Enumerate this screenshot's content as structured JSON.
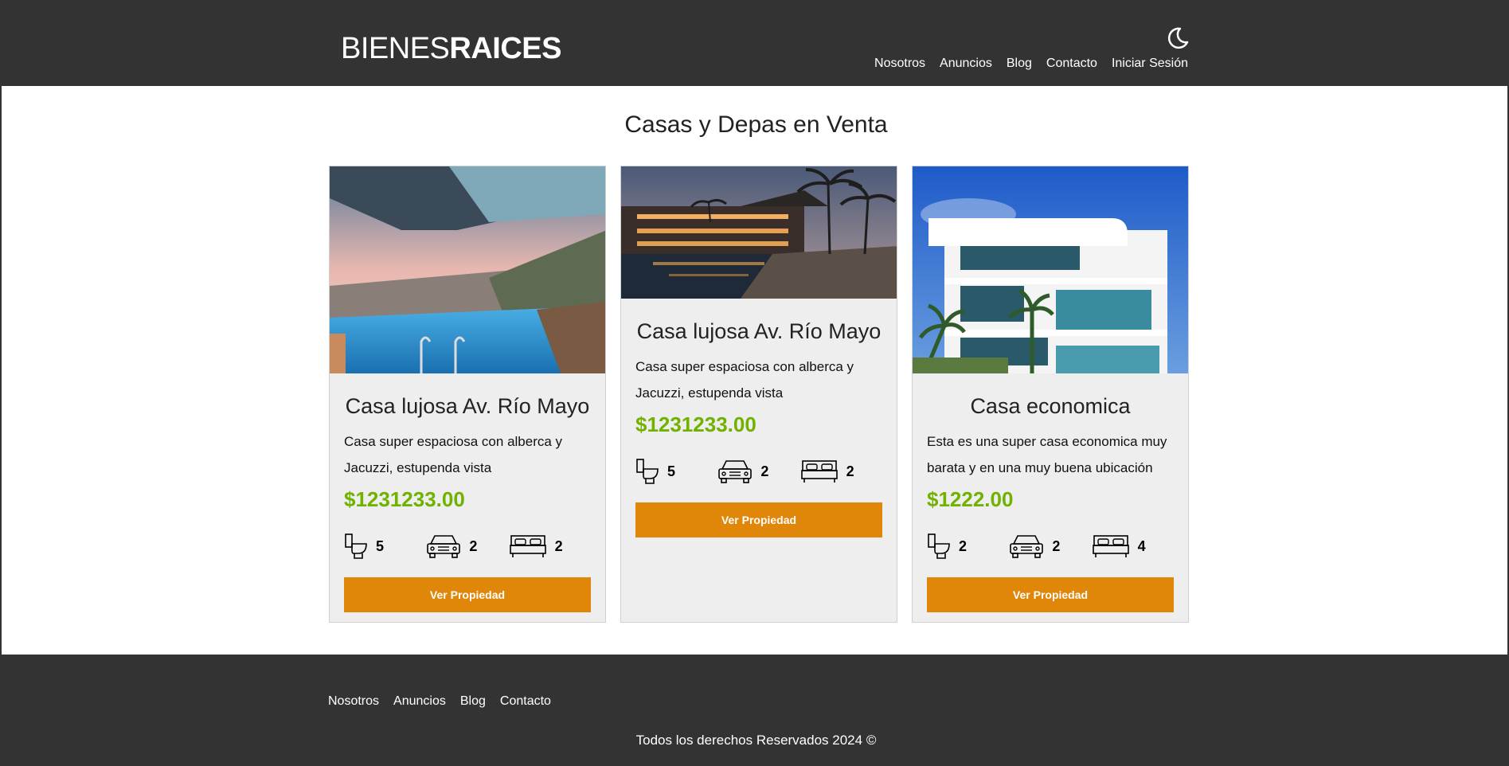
{
  "header": {
    "logo_light": "BIENES",
    "logo_bold": "RAICES",
    "theme_icon": "moon-icon",
    "nav": [
      "Nosotros",
      "Anuncios",
      "Blog",
      "Contacto",
      "Iniciar Sesión"
    ]
  },
  "main": {
    "title": "Casas y Depas en Venta",
    "cards": [
      {
        "image": "infinity-pool-sunset-photo",
        "title": "Casa lujosa Av. Río Mayo",
        "description": "Casa super espaciosa con alberca y Jacuzzi, estupenda vista",
        "price": "$1231233.00",
        "bathrooms": "5",
        "parking": "2",
        "bedrooms": "2",
        "button": "Ver Propiedad"
      },
      {
        "image": "resort-pool-night-photo",
        "title": "Casa lujosa Av. Río Mayo",
        "description": "Casa super espaciosa con alberca y Jacuzzi, estupenda vista",
        "price": "$1231233.00",
        "bathrooms": "5",
        "parking": "2",
        "bedrooms": "2",
        "button": "Ver Propiedad"
      },
      {
        "image": "modern-white-house-photo",
        "title": "Casa economica",
        "description": "Esta es una super casa economica muy barata y en una muy buena ubicación",
        "price": "$1222.00",
        "bathrooms": "2",
        "parking": "2",
        "bedrooms": "4",
        "button": "Ver Propiedad"
      }
    ]
  },
  "footer": {
    "nav": [
      "Nosotros",
      "Anuncios",
      "Blog",
      "Contacto"
    ],
    "copyright": "Todos los derechos Reservados 2024 ©"
  },
  "colors": {
    "header_bg": "#333333",
    "accent_orange": "#e08709",
    "price_green": "#71b100",
    "card_bg": "#eeeeee"
  }
}
